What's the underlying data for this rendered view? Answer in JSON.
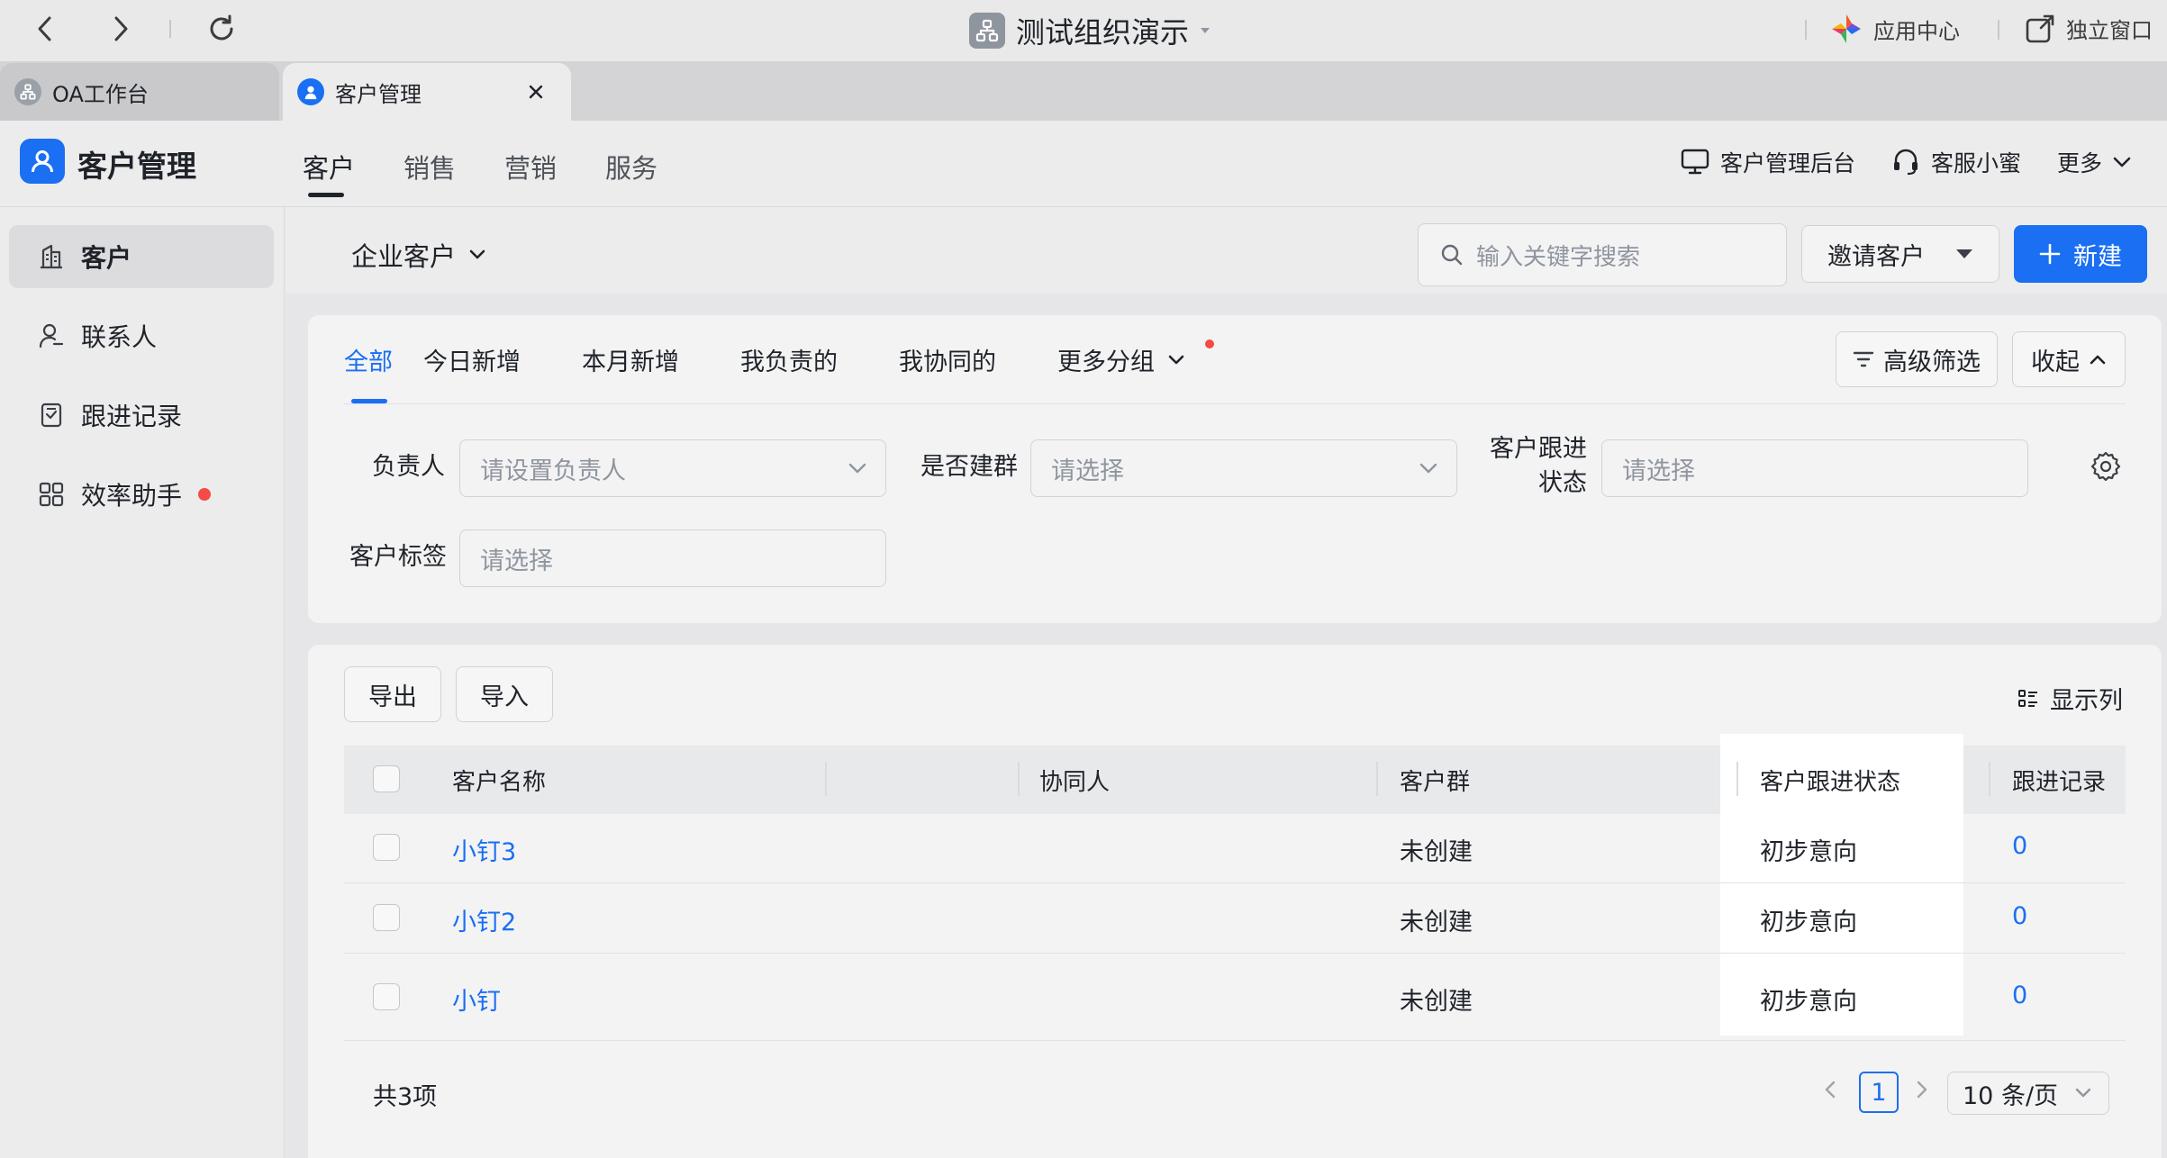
{
  "topbar": {
    "org_title": "测试组织演示",
    "app_center": "应用中心",
    "standalone_window": "独立窗口"
  },
  "tabs": [
    {
      "label": "OA工作台",
      "active": false
    },
    {
      "label": "客户管理",
      "active": true
    }
  ],
  "app": {
    "name": "客户管理",
    "nav": [
      "客户",
      "销售",
      "营销",
      "服务"
    ],
    "active_nav": "客户",
    "admin_console": "客户管理后台",
    "service_assistant": "客服小蜜",
    "more": "更多"
  },
  "sidebar": {
    "items": [
      {
        "label": "客户",
        "icon": "building-icon",
        "active": true
      },
      {
        "label": "联系人",
        "icon": "contact-icon",
        "active": false
      },
      {
        "label": "跟进记录",
        "icon": "record-icon",
        "active": false
      },
      {
        "label": "效率助手",
        "icon": "grid-icon",
        "active": false,
        "badge_dot": true
      }
    ]
  },
  "toolbar": {
    "view_select": "企业客户",
    "search_placeholder": "输入关键字搜索",
    "invite_label": "邀请客户",
    "new_label": "新建"
  },
  "filter": {
    "tabs": [
      "全部",
      "今日新增",
      "本月新增",
      "我负责的",
      "我协同的",
      "更多分组"
    ],
    "active_tab": "全部",
    "advanced_filter": "高级筛选",
    "collapse": "收起",
    "owner_label": "负责人",
    "owner_placeholder": "请设置负责人",
    "group_label": "是否建群",
    "group_placeholder": "请选择",
    "status_label_line1": "客户跟进",
    "status_label_line2": "状态",
    "status_placeholder": "请选择",
    "tag_label": "客户标签",
    "tag_placeholder": "请选择"
  },
  "table": {
    "export_label": "导出",
    "import_label": "导入",
    "display_columns": "显示列",
    "columns": [
      "客户名称",
      "协同人",
      "客户群",
      "客户跟进状态",
      "跟进记录"
    ],
    "rows": [
      {
        "name": "小钉3",
        "collaborator": "",
        "group": "未创建",
        "status": "初步意向",
        "records": "0"
      },
      {
        "name": "小钉2",
        "collaborator": "",
        "group": "未创建",
        "status": "初步意向",
        "records": "0"
      },
      {
        "name": "小钉",
        "collaborator": "",
        "group": "未创建",
        "status": "初步意向",
        "records": "0"
      }
    ]
  },
  "pagination": {
    "total": "共3项",
    "current_page": "1",
    "page_size": "10 条/页"
  },
  "colors": {
    "accent": "#1a6ff2",
    "badge_red": "#f54a45",
    "text": "#1f2329",
    "placeholder": "#8f959e"
  }
}
